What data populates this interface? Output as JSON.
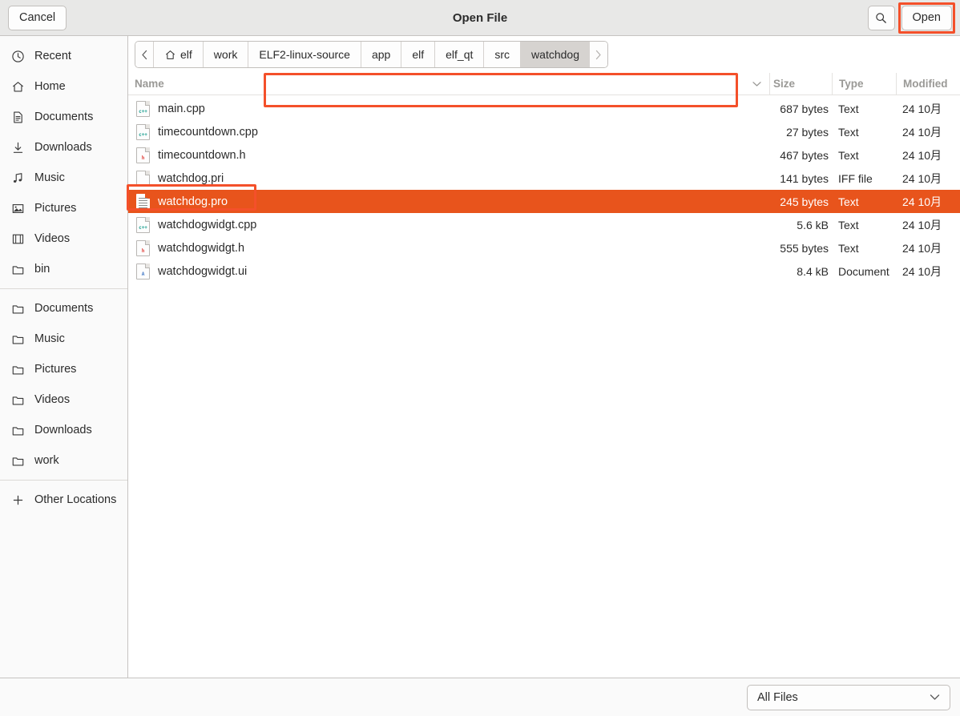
{
  "window": {
    "title": "Open File",
    "cancel_label": "Cancel",
    "open_label": "Open",
    "search_icon": "search-icon"
  },
  "sidebar": {
    "group1": [
      {
        "label": "Recent",
        "icon": "clock-icon"
      },
      {
        "label": "Home",
        "icon": "home-icon"
      },
      {
        "label": "Documents",
        "icon": "document-icon"
      },
      {
        "label": "Downloads",
        "icon": "download-icon"
      },
      {
        "label": "Music",
        "icon": "music-note-icon"
      },
      {
        "label": "Pictures",
        "icon": "picture-icon"
      },
      {
        "label": "Videos",
        "icon": "film-icon"
      },
      {
        "label": "bin",
        "icon": "folder-icon"
      }
    ],
    "group2": [
      {
        "label": "Documents",
        "icon": "folder-icon"
      },
      {
        "label": "Music",
        "icon": "folder-icon"
      },
      {
        "label": "Pictures",
        "icon": "folder-icon"
      },
      {
        "label": "Videos",
        "icon": "folder-icon"
      },
      {
        "label": "Downloads",
        "icon": "folder-icon"
      },
      {
        "label": "work",
        "icon": "folder-icon"
      }
    ],
    "other_locations": {
      "label": "Other Locations",
      "icon": "plus-icon"
    }
  },
  "pathbar": {
    "back_icon": "chevron-left-icon",
    "forward_icon": "chevron-right-icon",
    "crumbs": [
      {
        "label": "elf",
        "icon": "home-icon",
        "active": false
      },
      {
        "label": "work",
        "icon": "",
        "active": false
      },
      {
        "label": "ELF2-linux-source",
        "icon": "",
        "active": false
      },
      {
        "label": "app",
        "icon": "",
        "active": false
      },
      {
        "label": "elf",
        "icon": "",
        "active": false
      },
      {
        "label": "elf_qt",
        "icon": "",
        "active": false
      },
      {
        "label": "src",
        "icon": "",
        "active": false
      },
      {
        "label": "watchdog",
        "icon": "",
        "active": true
      }
    ]
  },
  "filelist": {
    "columns": {
      "name": "Name",
      "size": "Size",
      "type": "Type",
      "modified": "Modified",
      "sort_icon": "chevron-down-icon"
    },
    "rows": [
      {
        "name": "main.cpp",
        "size": "687 bytes",
        "type": "Text",
        "modified": "24 10月",
        "icon": "cpp-file-icon",
        "icon_tag": "c++",
        "selected": false
      },
      {
        "name": "timecountdown.cpp",
        "size": "27 bytes",
        "type": "Text",
        "modified": "24 10月",
        "icon": "cpp-file-icon",
        "icon_tag": "c++",
        "selected": false
      },
      {
        "name": "timecountdown.h",
        "size": "467 bytes",
        "type": "Text",
        "modified": "24 10月",
        "icon": "header-file-icon",
        "icon_tag": "h",
        "selected": false
      },
      {
        "name": "watchdog.pri",
        "size": "141 bytes",
        "type": "IFF file",
        "modified": "24 10月",
        "icon": "plain-file-icon",
        "icon_tag": "",
        "selected": false
      },
      {
        "name": "watchdog.pro",
        "size": "245 bytes",
        "type": "Text",
        "modified": "24 10月",
        "icon": "text-file-icon",
        "icon_tag": "",
        "selected": true
      },
      {
        "name": "watchdogwidgt.cpp",
        "size": "5.6 kB",
        "type": "Text",
        "modified": "24 10月",
        "icon": "cpp-file-icon",
        "icon_tag": "c++",
        "selected": false
      },
      {
        "name": "watchdogwidgt.h",
        "size": "555 bytes",
        "type": "Text",
        "modified": "24 10月",
        "icon": "header-file-icon",
        "icon_tag": "h",
        "selected": false
      },
      {
        "name": "watchdogwidgt.ui",
        "size": "8.4 kB",
        "type": "Document",
        "modified": "24 10月",
        "icon": "ui-file-icon",
        "icon_tag": "A",
        "selected": false
      }
    ]
  },
  "footer": {
    "filter_value": "All Files",
    "filter_chevron": "chevron-down-icon"
  },
  "colors": {
    "selection": "#e8541c",
    "annotation": "#f4502a",
    "headerbar": "#e8e8e7",
    "sidebar": "#fafafa"
  }
}
